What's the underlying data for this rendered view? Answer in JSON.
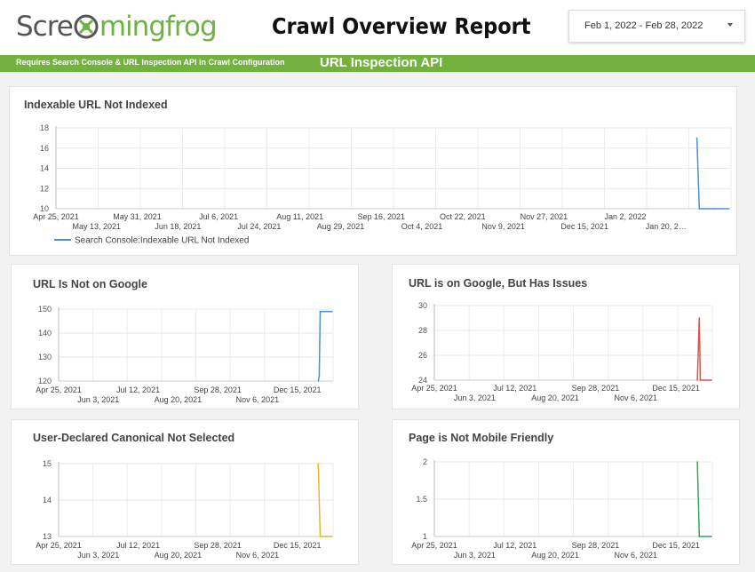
{
  "header": {
    "logo_part1": "Scre",
    "logo_part2": "mingfrog",
    "title": "Crawl Overview Report",
    "date_range": "Feb 1, 2022 - Feb 28, 2022"
  },
  "banner": {
    "note": "Requires Search Console & URL Inspection API in Crawl Configuration",
    "heading": "URL Inspection API"
  },
  "colors": {
    "green": "#73b23f",
    "blue": "#4a90d9",
    "red": "#d9534f",
    "yellow": "#f0b429",
    "darkgreen": "#34a853"
  },
  "chart_data": [
    {
      "type": "line",
      "title": "Indexable URL Not Indexed",
      "series": [
        {
          "name": "Search Console:Indexable URL Not Indexed",
          "color": "#4a90d9",
          "x": [
            "2022-01-13",
            "2022-01-14",
            "2022-01-20",
            "2022-01-26"
          ],
          "values": [
            17,
            10,
            10,
            10
          ]
        }
      ],
      "ylim": [
        10,
        18
      ],
      "yticks": [
        10,
        12,
        14,
        16,
        18
      ],
      "x_range": [
        "2021-04-25",
        "2022-01-27"
      ],
      "xticks_row1": [
        "Apr 25, 2021",
        "May 31, 2021",
        "Jul 6, 2021",
        "Aug 11, 2021",
        "Sep 16, 2021",
        "Oct 22, 2021",
        "Nov 27, 2021",
        "Jan 2, 2022"
      ],
      "xticks_row2": [
        "May 13, 2021",
        "Jun 18, 2021",
        "Jul 24, 2021",
        "Aug 29, 2021",
        "Oct 4, 2021",
        "Nov 9, 2021",
        "Dec 15, 2021",
        "Jan 20, 2…"
      ],
      "grid": true,
      "legend": "bottom-left"
    },
    {
      "type": "line",
      "title": "URL Is Not on Google",
      "series": [
        {
          "color": "#4a90d9",
          "x": [
            "2022-01-12",
            "2022-01-13",
            "2022-01-14",
            "2022-01-20",
            "2022-01-26"
          ],
          "values": [
            120,
            122,
            149,
            149,
            149
          ]
        }
      ],
      "ylim": [
        120,
        150
      ],
      "yticks": [
        120,
        130,
        140,
        150
      ],
      "x_range": [
        "2021-04-25",
        "2022-01-27"
      ],
      "xticks_row1": [
        "Apr 25, 2021",
        "Jul 12, 2021",
        "Sep 28, 2021",
        "Dec 15, 2021"
      ],
      "xticks_row2": [
        "Jun 3, 2021",
        "Aug 20, 2021",
        "Nov 6, 2021"
      ],
      "grid": true
    },
    {
      "type": "line",
      "title": "URL is on Google, But Has Issues",
      "series": [
        {
          "color": "#d9534f",
          "x": [
            "2022-01-12",
            "2022-01-14",
            "2022-01-15",
            "2022-01-20",
            "2022-01-26"
          ],
          "values": [
            24,
            29,
            24,
            24,
            24
          ]
        }
      ],
      "ylim": [
        24,
        30
      ],
      "yticks": [
        24,
        26,
        28,
        30
      ],
      "x_range": [
        "2021-04-25",
        "2022-01-27"
      ],
      "xticks_row1": [
        "Apr 25, 2021",
        "Jul 12, 2021",
        "Sep 28, 2021",
        "Dec 15, 2021"
      ],
      "xticks_row2": [
        "Jun 3, 2021",
        "Aug 20, 2021",
        "Nov 6, 2021"
      ],
      "grid": true
    },
    {
      "type": "line",
      "title": "User-Declared Canonical Not Selected",
      "series": [
        {
          "color": "#f0b429",
          "x": [
            "2022-01-12",
            "2022-01-14",
            "2022-01-20",
            "2022-01-26"
          ],
          "values": [
            15,
            13,
            13,
            13
          ]
        }
      ],
      "ylim": [
        13,
        15
      ],
      "yticks": [
        13,
        14,
        15
      ],
      "x_range": [
        "2021-04-25",
        "2022-01-27"
      ],
      "xticks_row1": [
        "Apr 25, 2021",
        "Jul 12, 2021",
        "Sep 28, 2021",
        "Dec 15, 2021"
      ],
      "xticks_row2": [
        "Jun 3, 2021",
        "Aug 20, 2021",
        "Nov 6, 2021"
      ],
      "grid": true
    },
    {
      "type": "line",
      "title": "Page is Not Mobile Friendly",
      "series": [
        {
          "color": "#34a853",
          "x": [
            "2022-01-12",
            "2022-01-14",
            "2022-01-20",
            "2022-01-26"
          ],
          "values": [
            2,
            1,
            1,
            1
          ]
        }
      ],
      "ylim": [
        1,
        2
      ],
      "yticks": [
        1,
        1.5,
        2
      ],
      "x_range": [
        "2021-04-25",
        "2022-01-27"
      ],
      "xticks_row1": [
        "Apr 25, 2021",
        "Jul 12, 2021",
        "Sep 28, 2021",
        "Dec 15, 2021"
      ],
      "xticks_row2": [
        "Jun 3, 2021",
        "Aug 20, 2021",
        "Nov 6, 2021"
      ],
      "grid": true
    }
  ]
}
